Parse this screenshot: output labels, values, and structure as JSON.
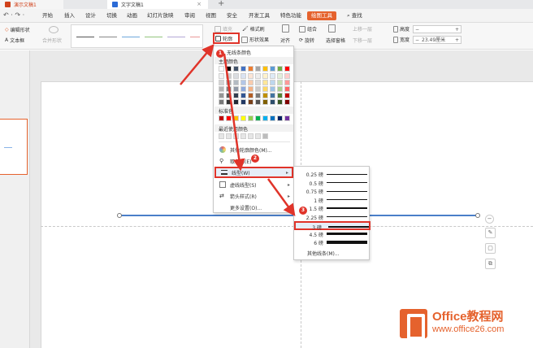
{
  "tabs": [
    {
      "label": "演示文稿1",
      "active": false
    },
    {
      "label": "文字文稿1",
      "active": true
    }
  ],
  "menu": [
    "开始",
    "插入",
    "设计",
    "切换",
    "动画",
    "幻灯片放映",
    "审阅",
    "视图",
    "安全",
    "开发工具",
    "特色功能",
    "绘图工具",
    "查找"
  ],
  "menu_active": "绘图工具",
  "ribbon": {
    "edit_shape": "编辑形状",
    "textbox": "文本框",
    "merge_shape": "合并形状",
    "fill": "填充",
    "format_painter": "格式刷",
    "outline": "轮廓",
    "shape_effect": "形状效果",
    "align": "对齐",
    "group": "组合",
    "rotate": "旋转",
    "selection_pane": "选择窗格",
    "bring_forward": "上移一层",
    "send_backward": "下移一层",
    "height_label": "高度",
    "width_label": "宽度",
    "width_value": "23.49厘米"
  },
  "color_menu": {
    "no_line_color": "无线条颜色",
    "theme_colors": "主题颜色",
    "standard_colors": "标准色",
    "recent_colors": "最近使用颜色",
    "more_colors": "其他轮廓颜色(M)...",
    "eyedropper": "取色器(E)",
    "line_style": "线型(W)",
    "dash_style": "虚线线型(S)",
    "arrow_style": "箭头样式(R)",
    "more_settings": "更多设置(O)...",
    "theme_row": [
      "#ffffff",
      "#000000",
      "#44546a",
      "#4472c4",
      "#ed7d31",
      "#a5a5a5",
      "#ffc000",
      "#5b9bd5",
      "#70ad47",
      "#ff0000"
    ],
    "standard_row": [
      "#c00000",
      "#ff0000",
      "#ffc000",
      "#ffff00",
      "#92d050",
      "#00b050",
      "#00b0f0",
      "#0070c0",
      "#002060",
      "#7030a0"
    ]
  },
  "line_widths": [
    {
      "label": "0.25 磅",
      "weight": 0.25
    },
    {
      "label": "0.5 磅",
      "weight": 0.5
    },
    {
      "label": "0.75 磅",
      "weight": 0.75
    },
    {
      "label": "1 磅",
      "weight": 1
    },
    {
      "label": "1.5 磅",
      "weight": 1.5
    },
    {
      "label": "2.25 磅",
      "weight": 2.25
    },
    {
      "label": "3 磅",
      "weight": 3
    },
    {
      "label": "4.5 磅",
      "weight": 4.5
    },
    {
      "label": "6 磅",
      "weight": 6
    }
  ],
  "line_widths_selected": "3 磅",
  "more_lines": "其他线条(M)...",
  "annotations": [
    "1",
    "2",
    "3"
  ],
  "watermark": {
    "title": "Office教程网",
    "url": "www.office26.com"
  },
  "colors": {
    "accent": "#e5622d",
    "highlight": "#e0342a",
    "shape_line": "#4a7fc9"
  }
}
